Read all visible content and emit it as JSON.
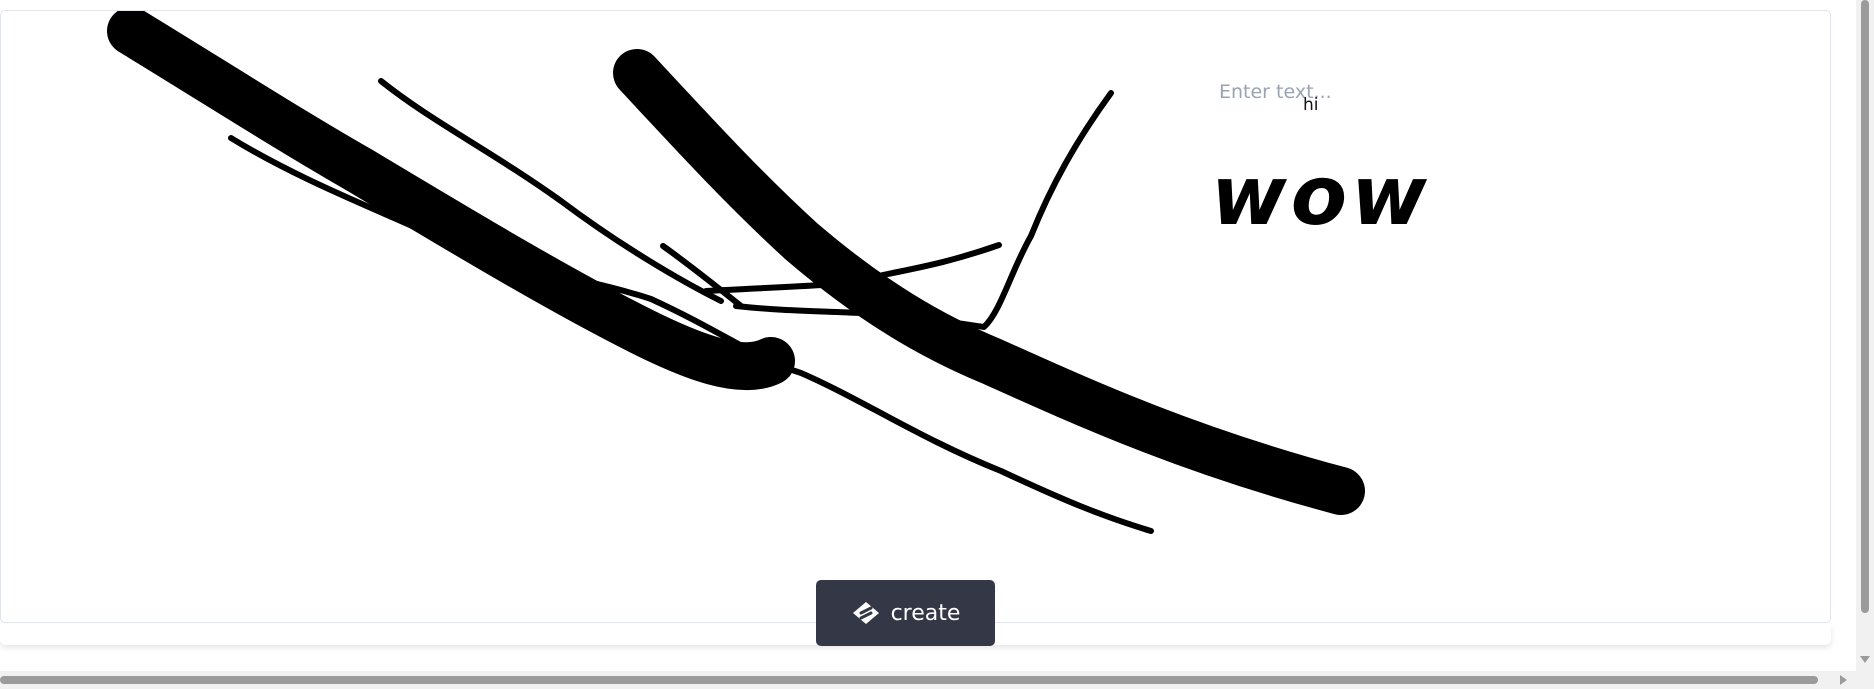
{
  "canvas": {
    "text_input_placeholder": "Enter text...",
    "text_items": [
      {
        "id": "hi",
        "text": "hi"
      },
      {
        "id": "wow",
        "text": "wow"
      }
    ],
    "stroke_color": "#000000"
  },
  "toolbar": {
    "create_label": "create",
    "create_icon": "logo-icon",
    "button_color": "#343746"
  },
  "footer": {
    "text": ""
  }
}
